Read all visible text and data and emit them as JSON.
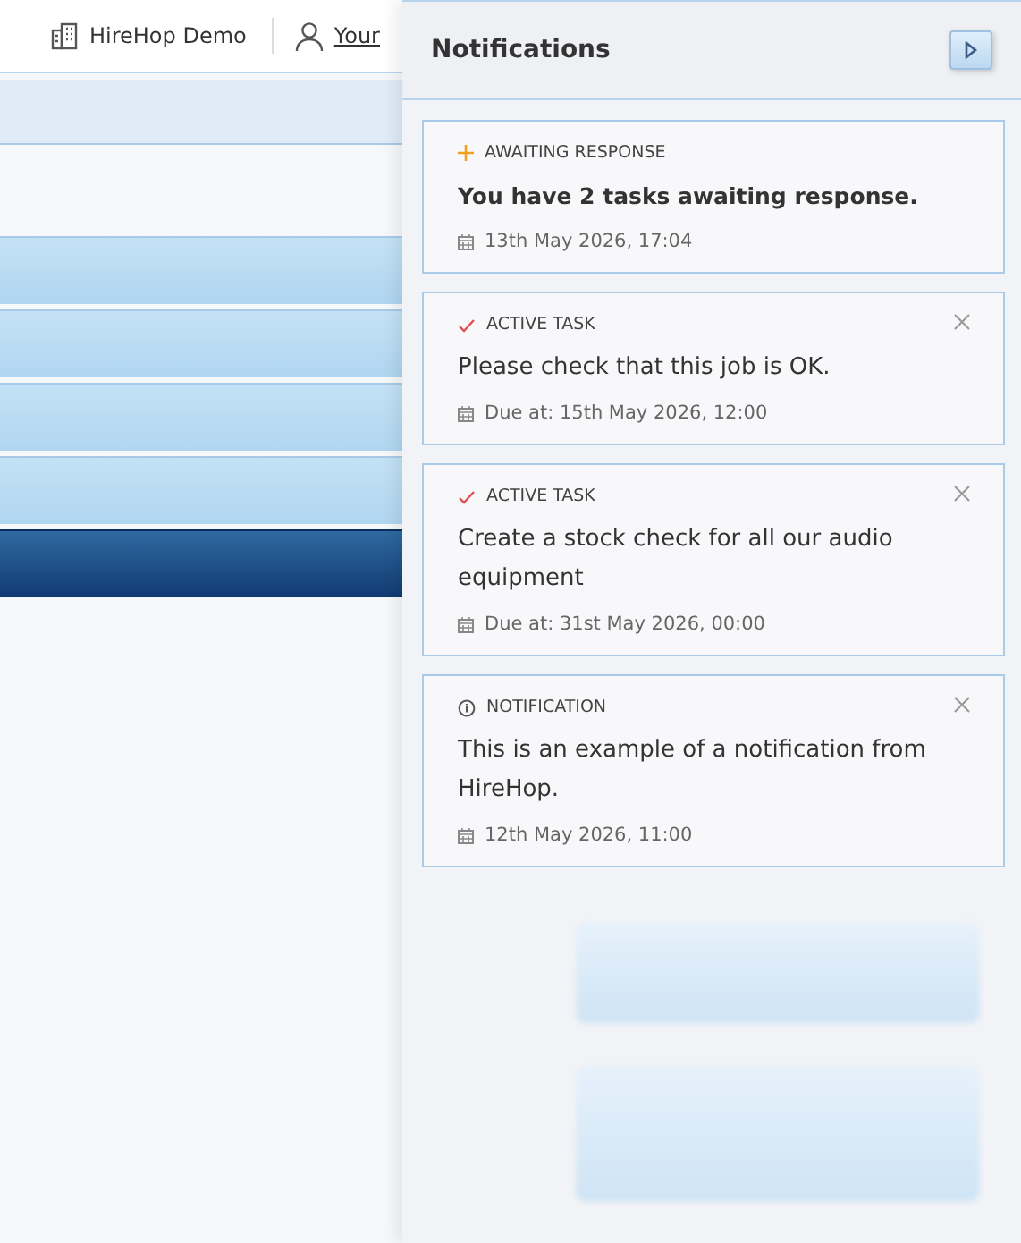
{
  "header": {
    "company": "HireHop Demo",
    "user": "Your"
  },
  "panel": {
    "title": "Notifications"
  },
  "notifications": [
    {
      "kind": "awaiting",
      "category": "AWAITING RESPONSE",
      "message": "You have 2 tasks awaiting response.",
      "emphasized": true,
      "closable": false,
      "date": "13th May 2026, 17:04"
    },
    {
      "kind": "task",
      "category": "ACTIVE TASK",
      "message": "Please check that this job is OK.",
      "emphasized": false,
      "closable": true,
      "date": "Due at: 15th May 2026, 12:00"
    },
    {
      "kind": "task",
      "category": "ACTIVE TASK",
      "message": "Create a stock check for all our audio equipment",
      "emphasized": false,
      "closable": true,
      "date": "Due at: 31st May 2026, 00:00"
    },
    {
      "kind": "info",
      "category": "NOTIFICATION",
      "message": "This is an example of a notification from HireHop.",
      "emphasized": false,
      "closable": true,
      "date": "12th May 2026, 11:00"
    }
  ]
}
